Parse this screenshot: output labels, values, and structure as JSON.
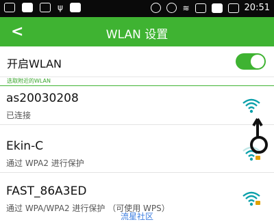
{
  "status_bar": {
    "time": "20:51"
  },
  "app_bar": {
    "back_label": "<",
    "title": "WLAN 设置"
  },
  "toggle": {
    "label": "开启WLAN",
    "on": true
  },
  "section_header": "选取附近的WLAN",
  "networks": [
    {
      "name": "as20030208",
      "status": "已连接"
    },
    {
      "name": "Ekin-C",
      "status": "通过 WPA2 进行保护"
    },
    {
      "name": "FAST_86A3ED",
      "status": "通过 WPA/WPA2 进行保护 （可使用 WPS）"
    }
  ],
  "watermark": "流星社区",
  "colors": {
    "accent": "#3fb332",
    "wifi_connected": "#0aa0aa",
    "wifi_other": "#0aa0aa",
    "status_bar": "#0a0a0a"
  }
}
